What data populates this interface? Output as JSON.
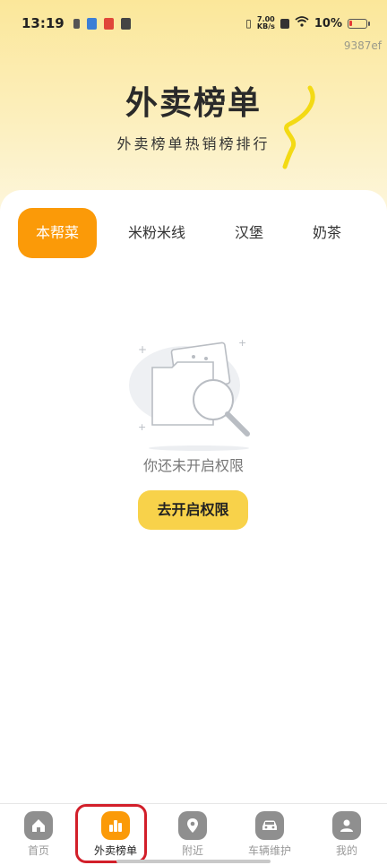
{
  "status_bar": {
    "time": "13:19",
    "net_speed_value": "7.00",
    "net_speed_unit": "KB/s",
    "battery_percent": "10%"
  },
  "build_id": "9387ef",
  "hero": {
    "title": "外卖榜单",
    "subtitle": "外卖榜单热销榜排行"
  },
  "tabs": [
    {
      "label": "本帮菜",
      "active": true
    },
    {
      "label": "米粉米线",
      "active": false
    },
    {
      "label": "汉堡",
      "active": false
    },
    {
      "label": "奶茶",
      "active": false
    }
  ],
  "empty_state": {
    "message": "你还未开启权限",
    "button_label": "去开启权限"
  },
  "bottom_nav": [
    {
      "label": "首页",
      "icon": "home-icon",
      "active": false
    },
    {
      "label": "外卖榜单",
      "icon": "chart-icon",
      "active": true
    },
    {
      "label": "附近",
      "icon": "location-pin-icon",
      "active": false
    },
    {
      "label": "车辆维护",
      "icon": "car-icon",
      "active": false
    },
    {
      "label": "我的",
      "icon": "user-icon",
      "active": false
    }
  ],
  "colors": {
    "accent": "#fb9a08",
    "button_yellow": "#f8d24a",
    "highlight_red": "#d21f2a",
    "header_yellow": "#fbe79a"
  }
}
